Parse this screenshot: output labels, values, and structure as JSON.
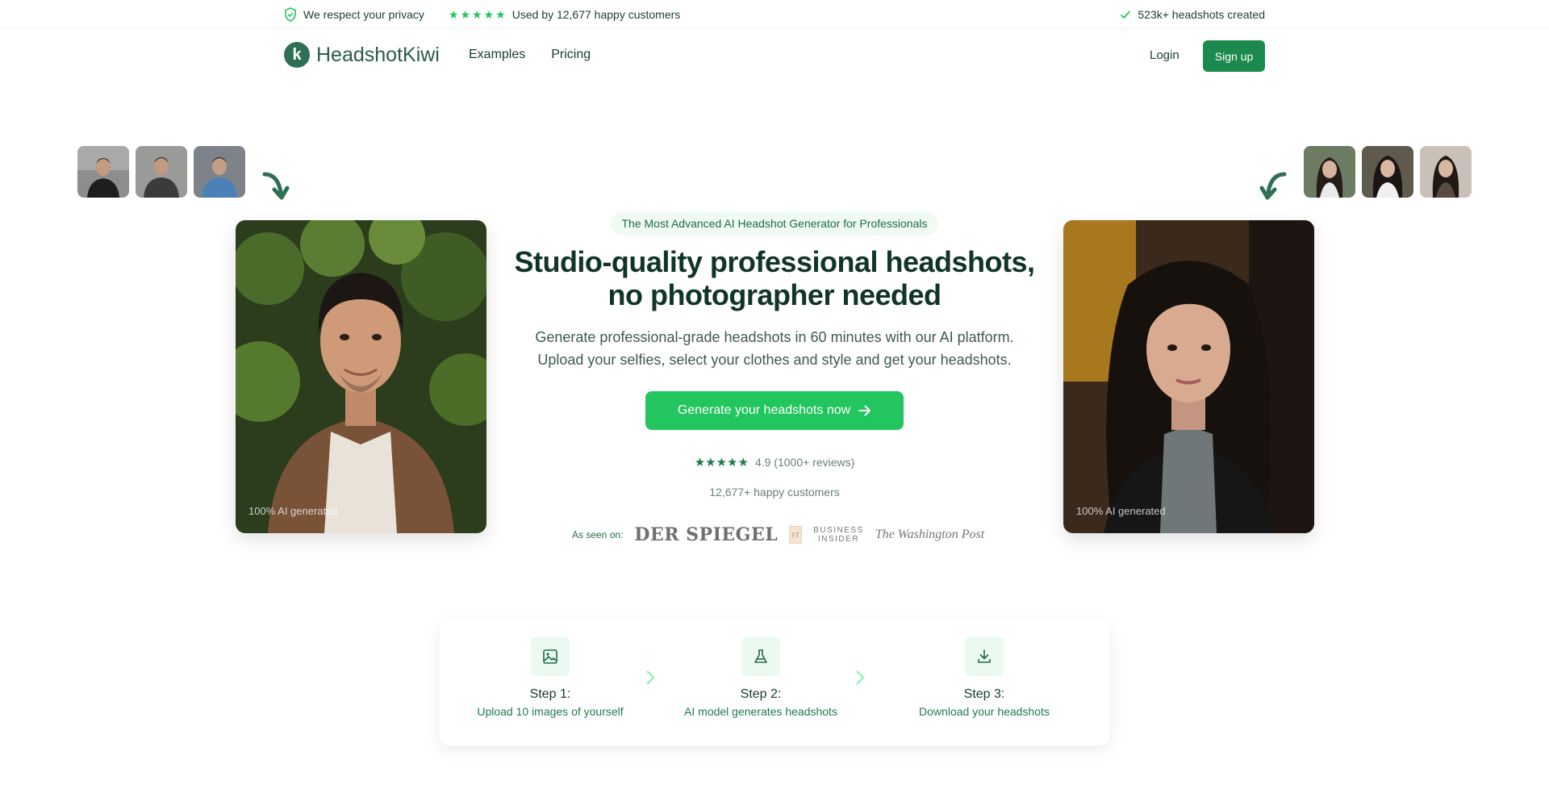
{
  "topbar": {
    "privacy": "We respect your privacy",
    "customers": "Used by 12,677 happy customers",
    "created": "523k+ headshots created"
  },
  "nav": {
    "brand": "HeadshotKiwi",
    "logo_letter": "k",
    "links": [
      "Examples",
      "Pricing"
    ],
    "login": "Login",
    "signup": "Sign up"
  },
  "hero": {
    "badge": "The Most Advanced AI Headshot Generator for Professionals",
    "title_line1": "Studio-quality professional headshots,",
    "title_line2": "no photographer needed",
    "sub_line1": "Generate professional-grade headshots in 60 minutes with our AI platform.",
    "sub_line2": "Upload your selfies, select your clothes and style and get your headshots.",
    "cta": "Generate your headshots now",
    "rating": "4.9 (1000+ reviews)",
    "happy": "12,677+ happy customers",
    "left_caption": "100% AI generated",
    "right_caption": "100% AI generated"
  },
  "press": {
    "label": "As seen on:",
    "spiegel": "DER SPIEGEL",
    "ft": "FT",
    "bi_line1": "BUSINESS",
    "bi_line2": "INSIDER",
    "wapo": "The Washington Post"
  },
  "steps": [
    {
      "title": "Step 1:",
      "desc": "Upload 10 images of yourself",
      "icon": "image-icon"
    },
    {
      "title": "Step 2:",
      "desc": "AI model generates headshots",
      "icon": "flask-icon"
    },
    {
      "title": "Step 3:",
      "desc": "Download your headshots",
      "icon": "download-icon"
    }
  ],
  "colors": {
    "brand_dark": "#2f6f55",
    "cta_green": "#22c55e",
    "signup_green": "#1d8a4d"
  }
}
